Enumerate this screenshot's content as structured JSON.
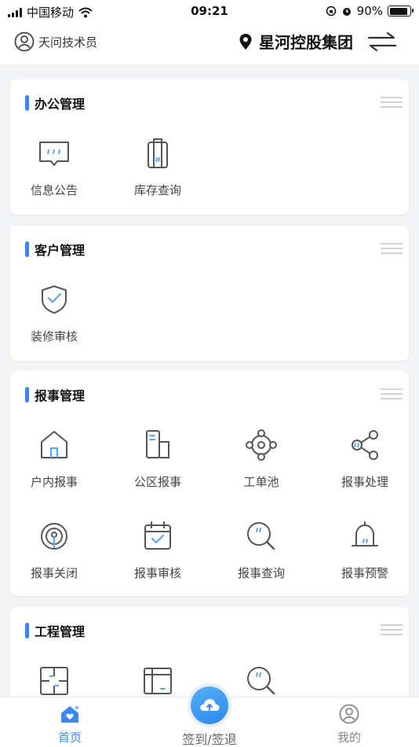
{
  "status_bar": {
    "carrier": "中国移动",
    "time": "09:21",
    "battery": "90%",
    "battery_level": 0.9
  },
  "header": {
    "user_name": "天问技术员",
    "org_name": "星河控股集团"
  },
  "sections": [
    {
      "title": "办公管理",
      "items": [
        {
          "label": "信息公告",
          "icon": "message-icon"
        },
        {
          "label": "库存查询",
          "icon": "luggage-icon"
        }
      ]
    },
    {
      "title": "客户管理",
      "items": [
        {
          "label": "装修审核",
          "icon": "shield-check-icon"
        }
      ]
    },
    {
      "title": "报事管理",
      "items": [
        {
          "label": "户内报事",
          "icon": "house-icon"
        },
        {
          "label": "公区报事",
          "icon": "building-icon"
        },
        {
          "label": "工单池",
          "icon": "network-icon"
        },
        {
          "label": "报事处理",
          "icon": "share-icon"
        },
        {
          "label": "报事关闭",
          "icon": "signal-icon"
        },
        {
          "label": "报事审核",
          "icon": "calendar-check-icon"
        },
        {
          "label": "报事查询",
          "icon": "search-icon"
        },
        {
          "label": "报事预警",
          "icon": "bell-icon"
        }
      ]
    },
    {
      "title": "工程管理",
      "items": [
        {
          "label": "",
          "icon": "grid-icon"
        },
        {
          "label": "",
          "icon": "box-icon"
        },
        {
          "label": "",
          "icon": "search-icon"
        }
      ]
    }
  ],
  "tabbar": {
    "home": "首页",
    "checkin": "签到/签退",
    "mine": "我的"
  },
  "colors": {
    "accent": "#3d86f5",
    "icon_stroke": "#555555",
    "icon_accent": "#5aa3ee"
  }
}
